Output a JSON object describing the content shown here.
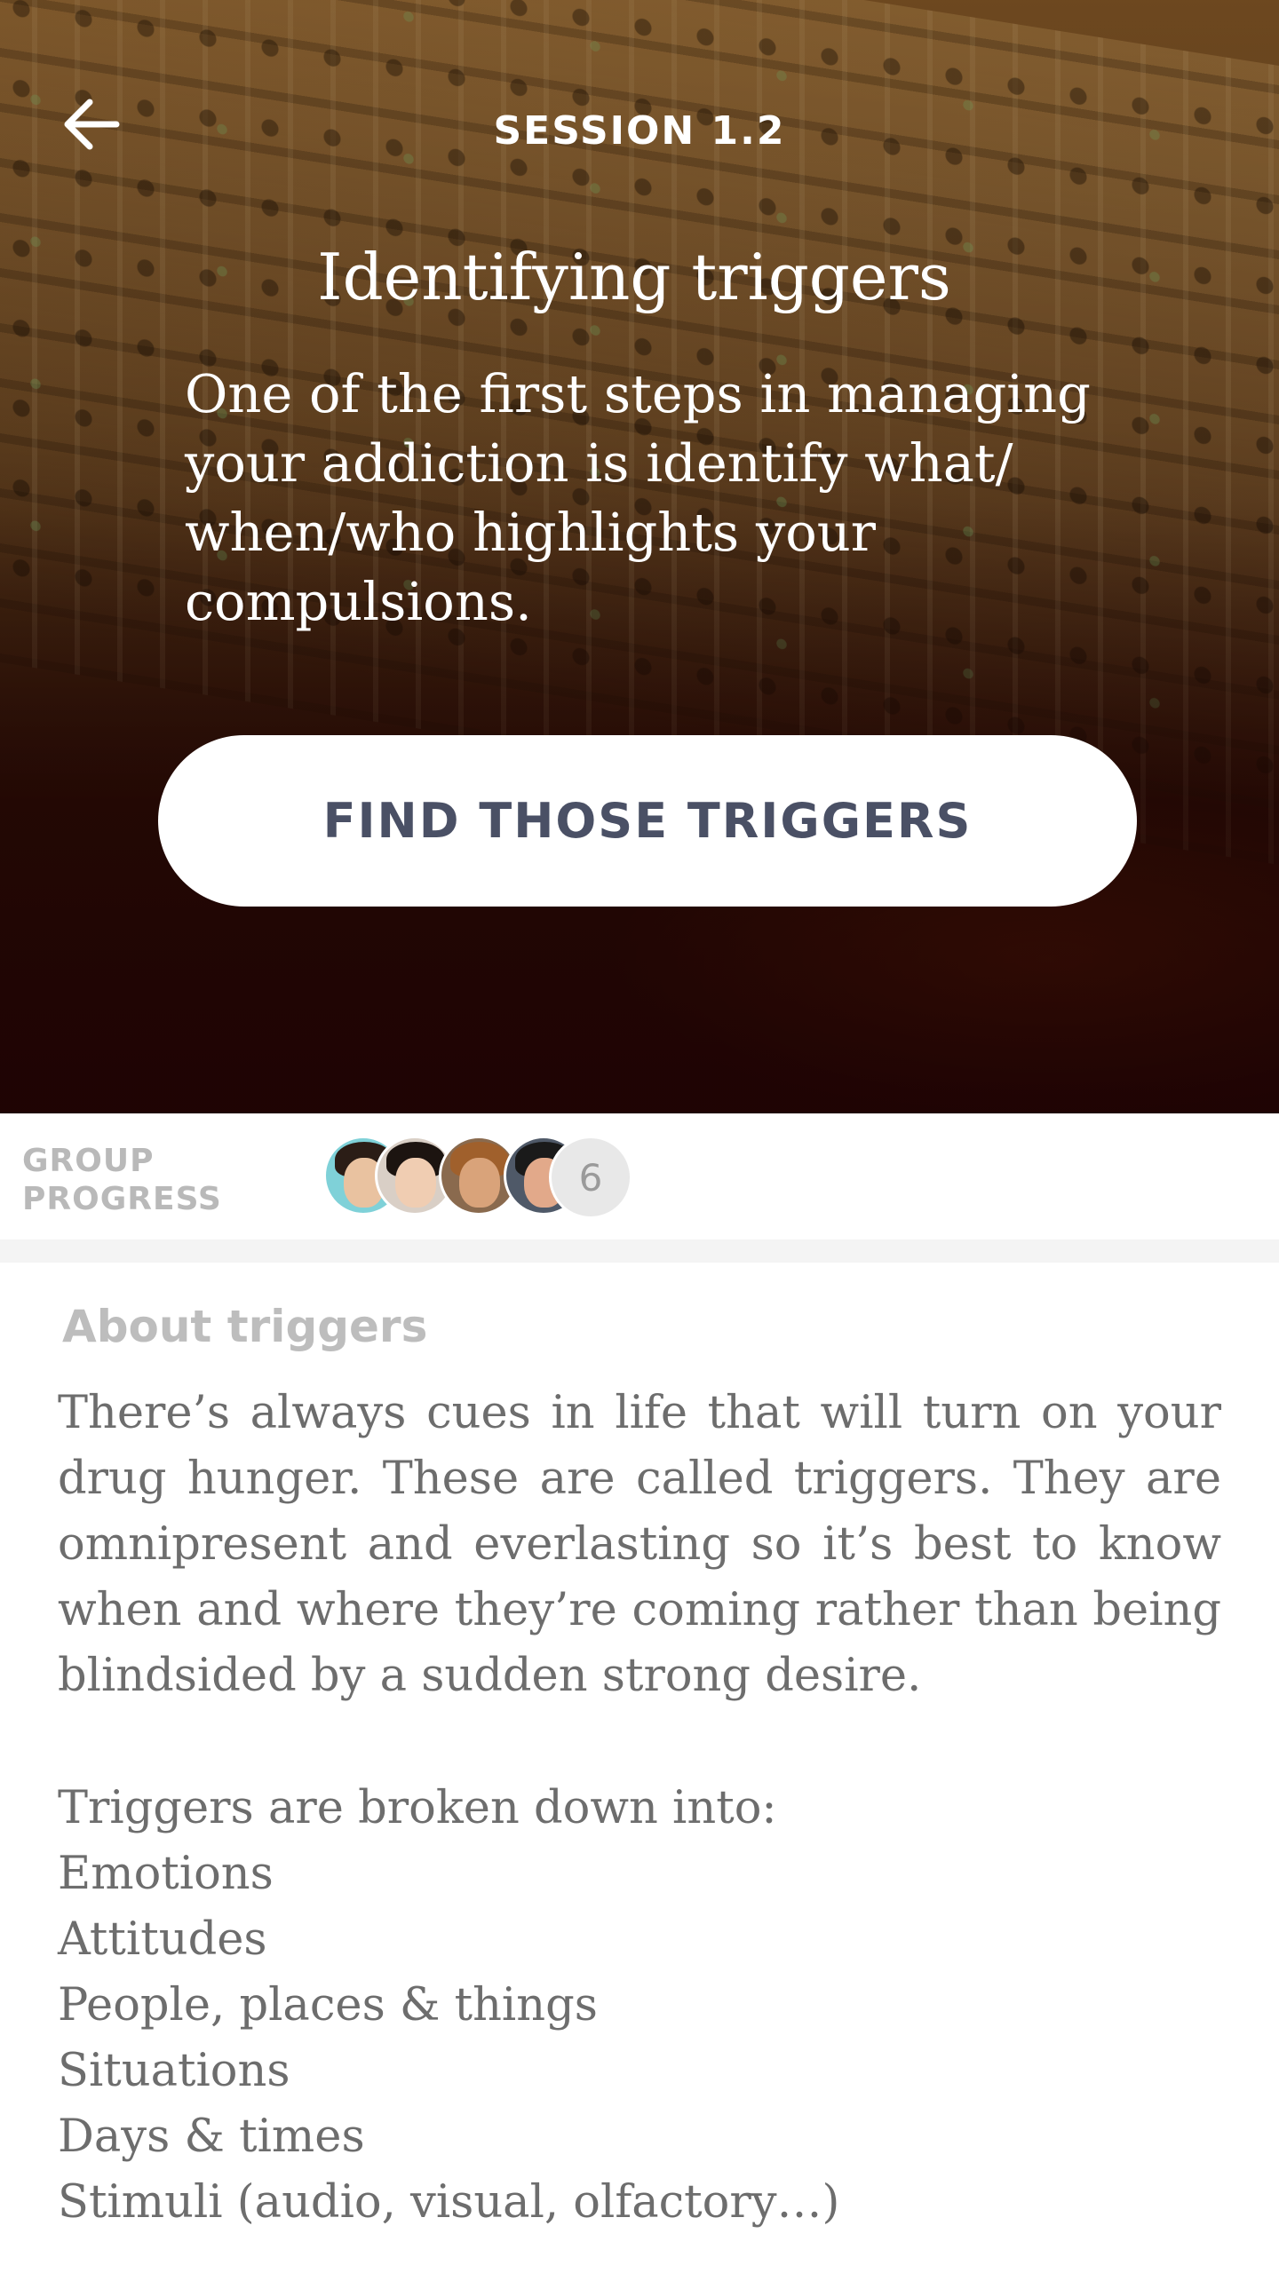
{
  "header": {
    "back_icon": "arrow-left-icon",
    "session_label": "SESSION 1.2",
    "title": "Identifying triggers",
    "description": "One of the first steps in managing your addiction is identify what/ when/who highlights your compulsions.",
    "cta_label": "FIND THOSE TRIGGERS"
  },
  "group_progress": {
    "label_line1": "GROUP",
    "label_line2": "PROGRESS",
    "avatars": [
      {
        "name": "member-1"
      },
      {
        "name": "member-2"
      },
      {
        "name": "member-3"
      },
      {
        "name": "member-4"
      }
    ],
    "more_count": "6"
  },
  "about": {
    "title": "About triggers",
    "body": "There’s always cues in life that will turn on your drug hunger. These are called triggers. They are omnipresent and everlasting so it’s best to know when and where they’re coming rather than being blindsided by a sudden strong desire.",
    "list_intro": "Triggers are broken down into:",
    "items": [
      "Emotions",
      "Attitudes",
      "People, places & things",
      "Situations",
      "Days & times",
      "Stimuli (audio, visual, olfactory…)"
    ]
  },
  "colors": {
    "cta_text": "#4a5065",
    "label_gray": "#b9b9b9",
    "body_text": "#6d6d6d",
    "hero_dark": "#220605"
  }
}
